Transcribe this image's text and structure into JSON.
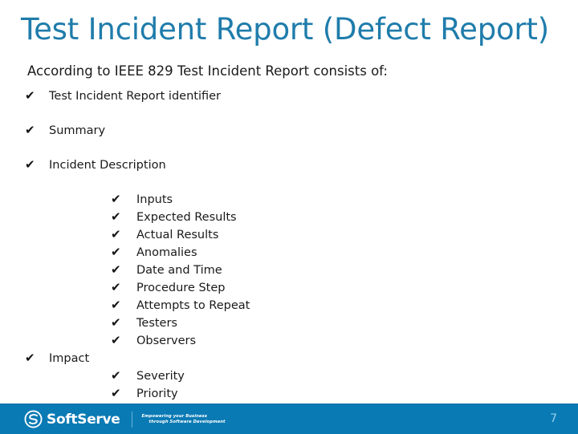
{
  "slide": {
    "title": "Test Incident Report (Defect Report)",
    "intro": "According to IEEE 829 Test Incident Report consists of:",
    "check_glyph": "✔",
    "title_color": "#1f7cab",
    "footer_color": "#0a7ab4",
    "page_number_color": "#8fd0ee"
  },
  "bullets": [
    {
      "level": 1,
      "label": "Test Incident Report identifier"
    },
    {
      "level": 1,
      "label": "Summary"
    },
    {
      "level": 1,
      "label": "Incident Description"
    },
    {
      "level": 2,
      "label": "Inputs"
    },
    {
      "level": 2,
      "label": "Expected Results"
    },
    {
      "level": 2,
      "label": "Actual Results"
    },
    {
      "level": 2,
      "label": "Anomalies"
    },
    {
      "level": 2,
      "label": "Date and Time"
    },
    {
      "level": 2,
      "label": "Procedure Step"
    },
    {
      "level": 2,
      "label": "Attempts to Repeat"
    },
    {
      "level": 2,
      "label": "Testers"
    },
    {
      "level": 2,
      "label": "Observers"
    },
    {
      "level": 1,
      "label": "Impact",
      "inline_with_gap": true
    },
    {
      "level": 2,
      "label": "Severity"
    },
    {
      "level": 2,
      "label": "Priority"
    }
  ],
  "footer": {
    "logo_name": "SoftServe",
    "tagline_line1": "Empowering your Business",
    "tagline_line2": "through Software Development",
    "page_number": "7"
  }
}
